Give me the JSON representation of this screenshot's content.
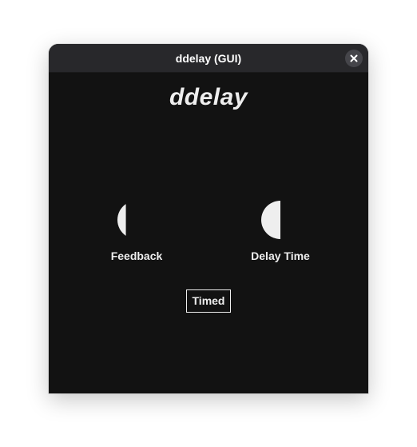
{
  "window": {
    "title": "ddelay (GUI)"
  },
  "plugin": {
    "name": "ddelay"
  },
  "knobs": [
    {
      "label": "Feedback",
      "value": 0.22
    },
    {
      "label": "Delay Time",
      "value": 0.5
    }
  ],
  "toggle": {
    "label": "Timed"
  },
  "colors": {
    "background": "#121212",
    "titlebar": "#28282b",
    "foreground": "#eeeeee"
  },
  "icons": {
    "close": "close-icon"
  }
}
